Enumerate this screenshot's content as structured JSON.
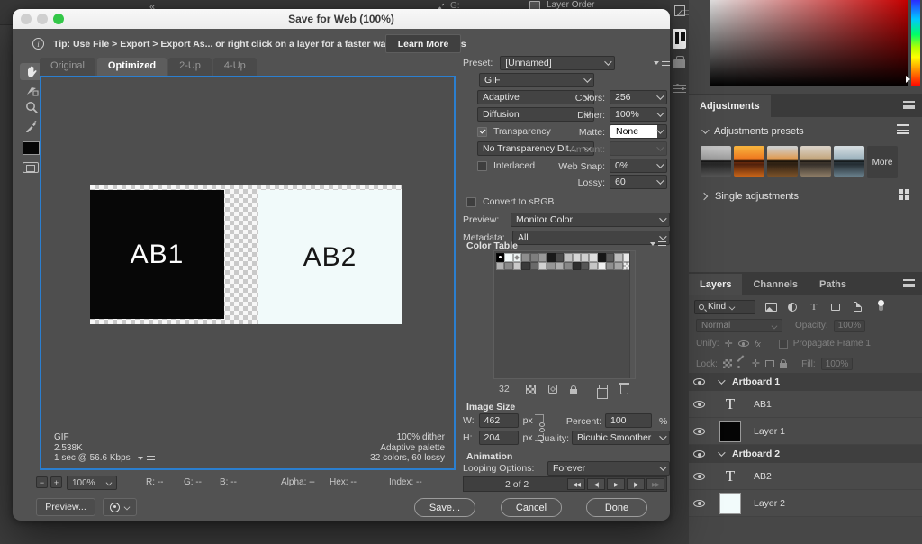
{
  "window": {
    "title": "Save for Web (100%)"
  },
  "tip": {
    "text": "Tip: Use File > Export > Export As...  or right click on a layer for a faster way to export assets",
    "learn_more": "Learn More"
  },
  "view_tabs": {
    "items": [
      "Original",
      "Optimized",
      "2-Up",
      "4-Up"
    ],
    "active": "Optimized"
  },
  "preview": {
    "canvas": {
      "ab1_text": "AB1",
      "ab2_text": "AB2"
    },
    "status_left": [
      "GIF",
      "2.538K",
      "1 sec @ 56.6 Kbps"
    ],
    "status_right": [
      "100% dither",
      "Adaptive palette",
      "32 colors, 60 lossy"
    ]
  },
  "zoom_bar": {
    "minus": "−",
    "plus": "+",
    "zoom_level": "100%",
    "fields": [
      {
        "label": "R:",
        "value": "--"
      },
      {
        "label": "G:",
        "value": "--"
      },
      {
        "label": "B:",
        "value": "--"
      },
      {
        "label": "Alpha:",
        "value": "--"
      },
      {
        "label": "Hex:",
        "value": "--"
      },
      {
        "label": "Index:",
        "value": "--"
      }
    ]
  },
  "actions": {
    "preview": "Preview...",
    "save": "Save...",
    "cancel": "Cancel",
    "done": "Done"
  },
  "settings": {
    "preset_label": "Preset:",
    "preset": "[Unnamed]",
    "format": "GIF",
    "palette": "Adaptive",
    "colors_label": "Colors:",
    "colors": "256",
    "dither_method": "Diffusion",
    "dither_label": "Dither:",
    "dither": "100%",
    "transparency_label": "Transparency",
    "transparency_checked": true,
    "matte_label": "Matte:",
    "matte": "None",
    "transparency_dither": "No Transparency Dit...",
    "amount_label": "Amount:",
    "amount": "",
    "interlaced_label": "Interlaced",
    "interlaced_checked": false,
    "web_snap_label": "Web Snap:",
    "web_snap": "0%",
    "lossy_label": "Lossy:",
    "lossy": "60",
    "convert_srgb_label": "Convert to sRGB",
    "convert_srgb_checked": false,
    "preview_label": "Preview:",
    "preview_value": "Monitor Color",
    "metadata_label": "Metadata:",
    "metadata_value": "All"
  },
  "color_table": {
    "title": "Color Table",
    "count": "32",
    "swatches": [
      {
        "color": "#000000",
        "mark": "dot"
      },
      {
        "color": "#f4fafa",
        "mark": null
      },
      {
        "color": "#eef4f4",
        "mark": "diamond"
      },
      {
        "color": "#8e8e8e",
        "mark": null
      },
      {
        "color": "#7f7f7f",
        "mark": null
      },
      {
        "color": "#9a9a9a",
        "mark": null
      },
      {
        "color": "#1a1a1a",
        "mark": null
      },
      {
        "color": "#4a4a4a",
        "mark": null
      },
      {
        "color": "#c2c2c2",
        "mark": null
      },
      {
        "color": "#d6d6d6",
        "mark": null
      },
      {
        "color": "#cfcfcf",
        "mark": null
      },
      {
        "color": "#dedede",
        "mark": null
      },
      {
        "color": "#161616",
        "mark": null
      },
      {
        "color": "#5a5a5a",
        "mark": null
      },
      {
        "color": "#bcbcbc",
        "mark": null
      },
      {
        "color": "#e8e8e8",
        "mark": null
      },
      {
        "color": "#b2b2b2",
        "mark": null
      },
      {
        "color": "#8a8a8a",
        "mark": null
      },
      {
        "color": "#cacaca",
        "mark": null
      },
      {
        "color": "#3a3a3a",
        "mark": null
      },
      {
        "color": "#6a6a6a",
        "mark": null
      },
      {
        "color": "#d2d2d2",
        "mark": null
      },
      {
        "color": "#969696",
        "mark": null
      },
      {
        "color": "#aeaeae",
        "mark": null
      },
      {
        "color": "#888888",
        "mark": null
      },
      {
        "color": "#2e2e2e",
        "mark": null
      },
      {
        "color": "#565656",
        "mark": null
      },
      {
        "color": "#c6c6c6",
        "mark": null
      },
      {
        "color": "#f0f0f0",
        "mark": null
      },
      {
        "color": "#909090",
        "mark": null
      },
      {
        "color": "#a6a6a6",
        "mark": null
      },
      {
        "color": "",
        "mark": "checker"
      }
    ]
  },
  "image_size": {
    "title": "Image Size",
    "w_label": "W:",
    "w": "462",
    "h_label": "H:",
    "h": "204",
    "unit": "px",
    "percent_label": "Percent:",
    "percent": "100",
    "percent_unit": "%",
    "quality_label": "Quality:",
    "quality": "Bicubic Smoother"
  },
  "animation": {
    "title": "Animation",
    "looping_label": "Looping Options:",
    "looping": "Forever",
    "frame": "2 of 2",
    "buttons": [
      "◀◀",
      "◀|",
      "▶",
      "|▶",
      "▶▶"
    ]
  },
  "background": {
    "top_bar": {
      "collapse": "«",
      "g_label": "G:",
      "history_item": "Layer Order"
    },
    "adjustments": {
      "tab": "Adjustments",
      "presets_label": "Adjustments presets",
      "more": "More",
      "single_label": "Single adjustments"
    },
    "layers_panel": {
      "tabs": [
        "Layers",
        "Channels",
        "Paths"
      ],
      "active_tab": "Layers",
      "kind": "Kind",
      "blend": "Normal",
      "opacity_label": "Opacity:",
      "opacity": "100%",
      "unify_label": "Unify:",
      "propagate": "Propagate Frame 1",
      "lock_label": "Lock:",
      "fill_label": "Fill:",
      "fill": "100%",
      "rows": [
        {
          "type": "group",
          "name": "Artboard 1"
        },
        {
          "type": "text",
          "name": "AB1"
        },
        {
          "type": "fill",
          "name": "Layer 1",
          "thumb": "#050505"
        },
        {
          "type": "group",
          "name": "Artboard 2"
        },
        {
          "type": "text",
          "name": "AB2"
        },
        {
          "type": "fill",
          "name": "Layer 2",
          "thumb": "#f2fbfb"
        }
      ]
    }
  },
  "colors": {
    "accent_blue": "#2b7fd0",
    "matte_value_bg": "#ffffff",
    "dialog_bg": "#525252"
  }
}
